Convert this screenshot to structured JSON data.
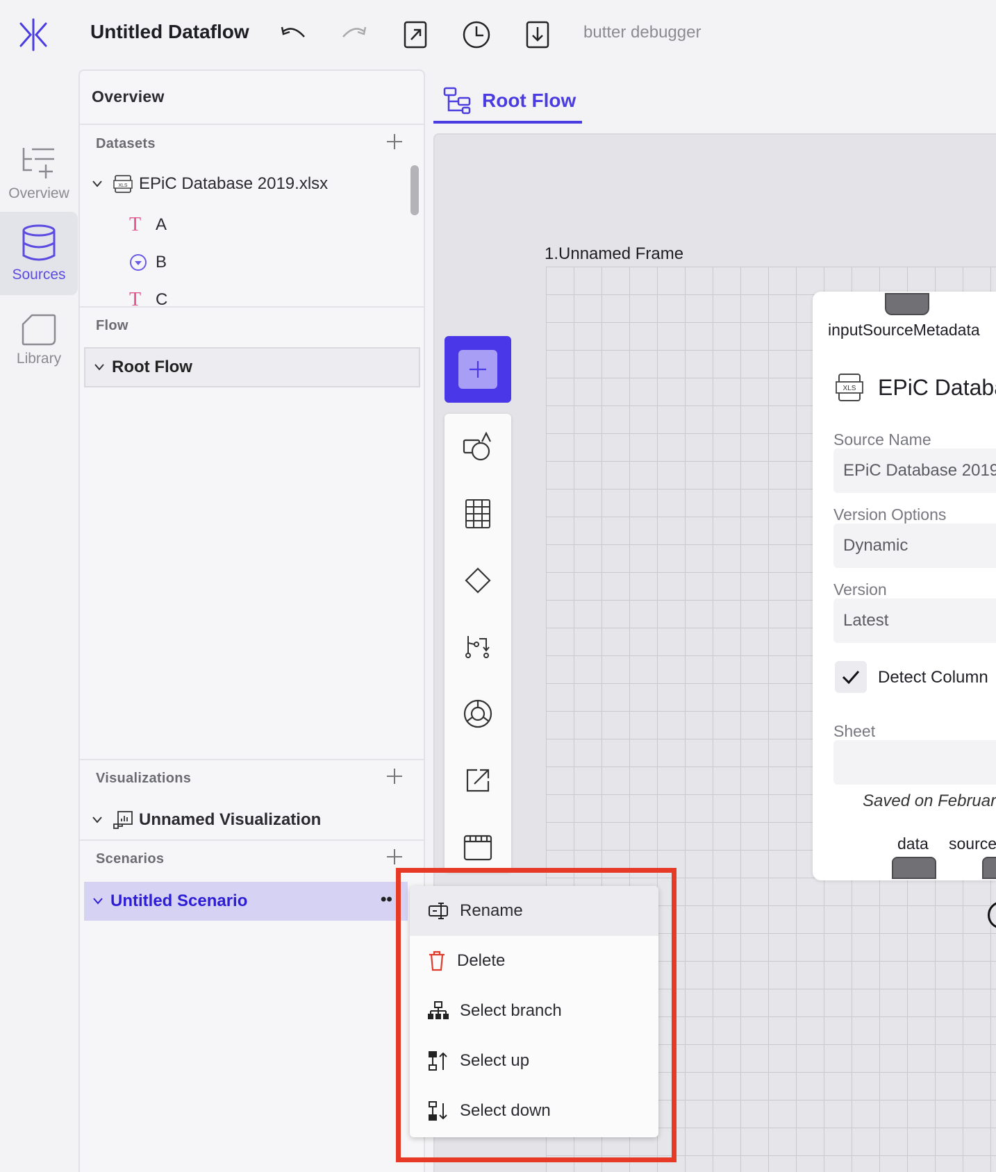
{
  "header": {
    "app_title": "Untitled Dataflow",
    "debugger_label": "butter debugger",
    "icons": [
      "logo-icon",
      "undo-icon",
      "redo-icon",
      "export-icon",
      "history-icon",
      "download-icon"
    ]
  },
  "nav": {
    "items": [
      {
        "label": "Overview",
        "icon": "overview-icon",
        "active": false
      },
      {
        "label": "Sources",
        "icon": "database-icon",
        "active": true
      },
      {
        "label": "Library",
        "icon": "library-icon",
        "active": false
      }
    ]
  },
  "panel": {
    "title": "Overview",
    "datasets": {
      "label": "Datasets",
      "file": "EPiC Database 2019.xlsx",
      "columns": [
        {
          "name": "A",
          "type_icon": "text-type-icon"
        },
        {
          "name": "B",
          "type_icon": "category-type-icon"
        },
        {
          "name": "C",
          "type_icon": "text-type-icon"
        }
      ]
    },
    "flow": {
      "label": "Flow",
      "root": "Root Flow"
    },
    "visualizations": {
      "label": "Visualizations",
      "item": "Unnamed Visualization"
    },
    "scenarios": {
      "label": "Scenarios",
      "item": "Untitled Scenario",
      "more": "••"
    }
  },
  "tab": {
    "label": "Root Flow"
  },
  "canvas": {
    "frame_label": "1.Unnamed Frame",
    "node": {
      "top_port": "inputSourceMetadata",
      "title": "EPiC Databa",
      "fields": [
        {
          "label": "Source Name",
          "value": "EPiC Database 2019"
        },
        {
          "label": "Version Options",
          "value": "Dynamic"
        },
        {
          "label": "Version",
          "value": "Latest"
        }
      ],
      "checkbox_label": "Detect Column",
      "sheet_label": "Sheet",
      "sheet_value": "",
      "saved_text": "Saved on Februar",
      "bottom_ports": [
        "data",
        "source"
      ]
    }
  },
  "context_menu": {
    "items": [
      {
        "label": "Rename",
        "icon": "rename-icon"
      },
      {
        "label": "Delete",
        "icon": "trash-icon"
      },
      {
        "label": "Select branch",
        "icon": "branch-icon"
      },
      {
        "label": "Select up",
        "icon": "select-up-icon"
      },
      {
        "label": "Select down",
        "icon": "select-down-icon"
      }
    ]
  },
  "colors": {
    "accent": "#4a3ce0",
    "highlight": "#e63a26",
    "delete": "#e03b2a"
  }
}
